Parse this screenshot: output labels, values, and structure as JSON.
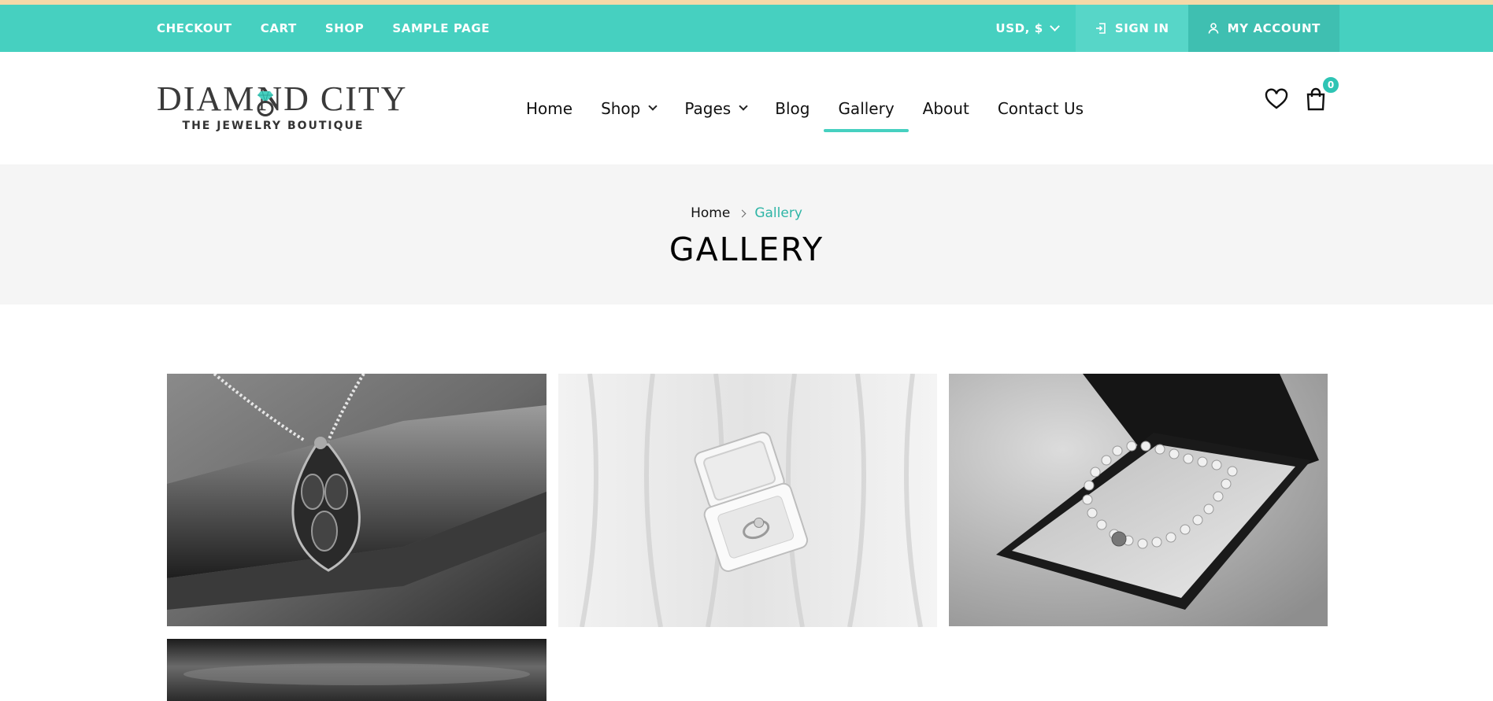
{
  "topbar": {
    "links": [
      "CHECKOUT",
      "CART",
      "SHOP",
      "SAMPLE PAGE"
    ],
    "currency": "USD, $",
    "sign_in": "SIGN IN",
    "my_account": "MY ACCOUNT"
  },
  "header": {
    "logo_title_left": "DIAM",
    "logo_title_right": "ND CITY",
    "logo_subtitle": "THE JEWELRY BOUTIQUE",
    "nav": {
      "home": "Home",
      "shop": "Shop",
      "pages": "Pages",
      "blog": "Blog",
      "gallery": "Gallery",
      "about": "About",
      "contact": "Contact Us"
    },
    "active_nav": "Gallery",
    "cart_count": "0"
  },
  "page_header": {
    "breadcrumb_home": "Home",
    "breadcrumb_current": "Gallery",
    "title": "GALLERY"
  },
  "gallery": {
    "images": [
      "pendant-necklace-photo",
      "ring-box-photo",
      "pearl-necklace-photo",
      "dark-jewelry-photo"
    ]
  },
  "colors": {
    "topbar": "#46d0c0",
    "accent": "#2ec4b4",
    "band": "#f5f5f5",
    "accent_line": "#f5d9a8"
  }
}
